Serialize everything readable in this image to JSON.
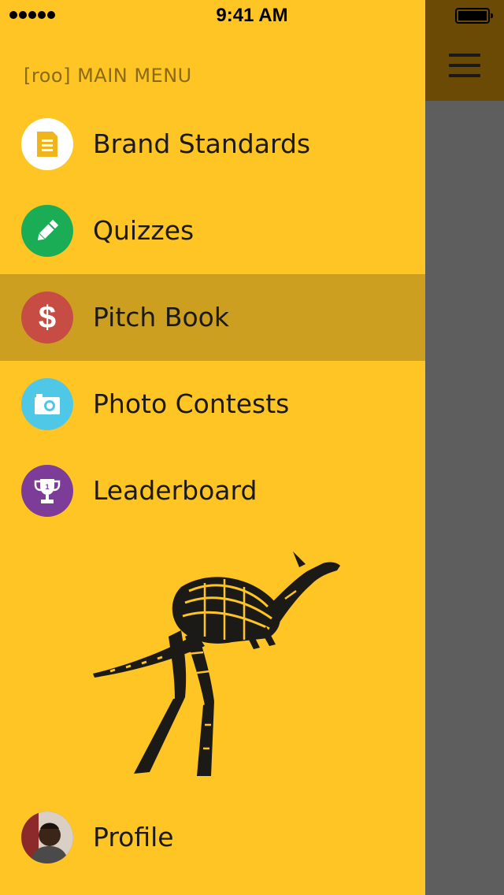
{
  "status_bar": {
    "time": "9:41 AM"
  },
  "menu": {
    "heading": "[roo] MAIN MENU",
    "items": [
      {
        "label": "Brand Standards",
        "icon": "document-icon",
        "color": "#ffffff",
        "active": false
      },
      {
        "label": "Quizzes",
        "icon": "pencil-icon",
        "color": "#1aad56",
        "active": false
      },
      {
        "label": "Pitch Book",
        "icon": "dollar-icon",
        "color": "#c64c44",
        "active": true
      },
      {
        "label": "Photo Contests",
        "icon": "camera-icon",
        "color": "#4ec8e6",
        "active": false
      },
      {
        "label": "Leaderboard",
        "icon": "trophy-icon",
        "color": "#7d3c98",
        "active": false
      }
    ],
    "profile": {
      "label": "Profile",
      "icon": "avatar"
    }
  },
  "colors": {
    "drawer_bg": "#fec524",
    "active_row": "#cc9f21",
    "header_peek": "#6b4a06",
    "content_peek": "#5e5e5e"
  }
}
